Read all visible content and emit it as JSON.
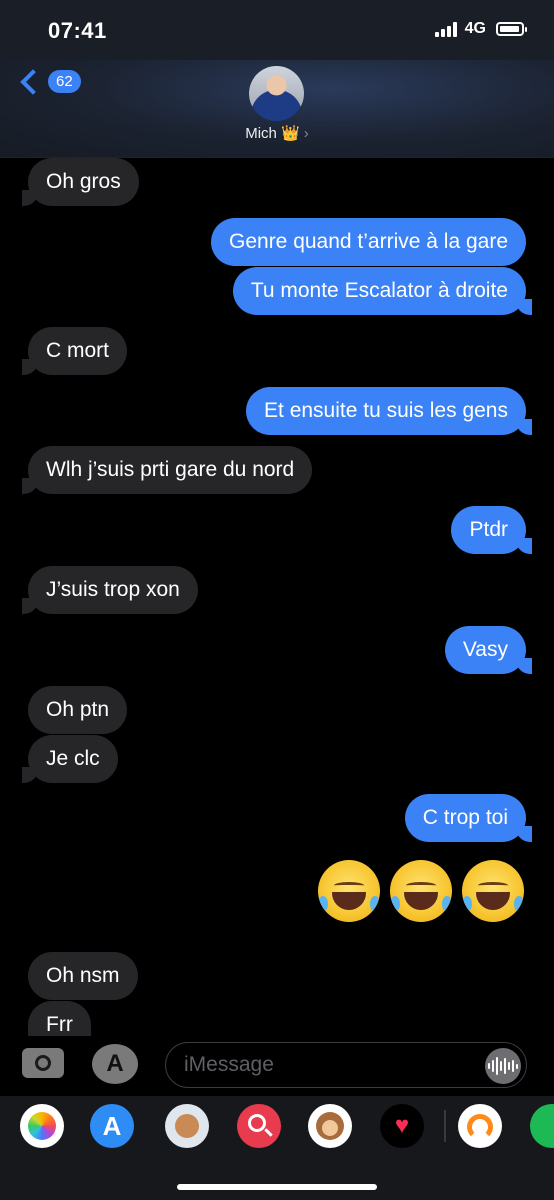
{
  "status_bar": {
    "time": "07:41",
    "network": "4G"
  },
  "header": {
    "back_count": "62",
    "contact_name": "Mich 👑"
  },
  "messages": [
    {
      "side": "in",
      "text": "Oh gros"
    },
    {
      "side": "out",
      "text": "Genre quand t’arrive à la gare"
    },
    {
      "side": "out",
      "text": "Tu monte Escalator à droite"
    },
    {
      "side": "in",
      "text": "C mort"
    },
    {
      "side": "out",
      "text": "Et ensuite tu suis les gens"
    },
    {
      "side": "in",
      "text": "Wlh j’suis prti gare du nord"
    },
    {
      "side": "out",
      "text": "Ptdr"
    },
    {
      "side": "in",
      "text": "J’suis trop xon"
    },
    {
      "side": "out",
      "text": "Vasy"
    },
    {
      "side": "in",
      "text": "Oh ptn"
    },
    {
      "side": "in",
      "text": "Je clc"
    },
    {
      "side": "out",
      "text": "C trop toi"
    },
    {
      "side": "out",
      "emoji": "😂😂😂"
    },
    {
      "side": "in",
      "text": "Oh nsm"
    },
    {
      "side": "in",
      "text": "Frr"
    }
  ],
  "composer": {
    "placeholder": "iMessage"
  },
  "app_drawer": [
    "photos-icon",
    "app-store-icon",
    "memoji-icon",
    "web-search-icon",
    "animoji-icon",
    "digital-touch-icon",
    "arc-app-icon",
    "spotify-icon"
  ],
  "colors": {
    "outgoing": "#3b82f6",
    "incoming": "#262628",
    "background": "#000000"
  }
}
